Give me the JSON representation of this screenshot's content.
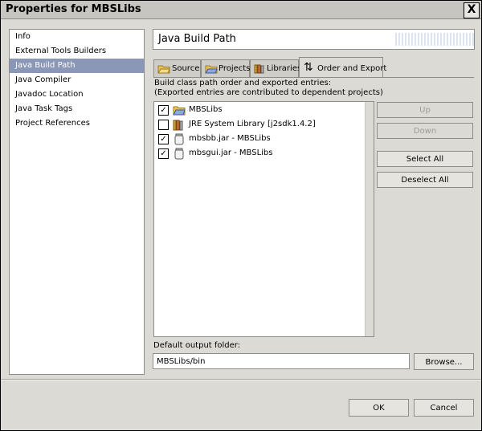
{
  "window": {
    "title": "Properties for MBSLibs",
    "close_glyph": "X"
  },
  "nav": {
    "items": [
      {
        "label": "Info"
      },
      {
        "label": "External Tools Builders"
      },
      {
        "label": "Java Build Path",
        "selected": true
      },
      {
        "label": "Java Compiler"
      },
      {
        "label": "Javadoc Location"
      },
      {
        "label": "Java Task Tags"
      },
      {
        "label": "Project References"
      }
    ]
  },
  "page": {
    "title": "Java Build Path"
  },
  "tabs": [
    {
      "label": "Source",
      "icon": "source-folder-icon"
    },
    {
      "label": "Projects",
      "icon": "project-folder-icon"
    },
    {
      "label": "Libraries",
      "icon": "libraries-icon"
    },
    {
      "label": "Order and Export",
      "icon": "order-arrows-icon",
      "active": true
    }
  ],
  "order_export": {
    "description_line1": "Build class path order and exported entries:",
    "description_line2": "(Exported entries are contributed to dependent projects)",
    "entries": [
      {
        "label": "MBSLibs",
        "checked": true,
        "icon": "project-folder-icon"
      },
      {
        "label": "JRE System Library [j2sdk1.4.2]",
        "checked": false,
        "icon": "library-books-icon"
      },
      {
        "label": "mbsbb.jar - MBSLibs",
        "checked": true,
        "icon": "jar-icon"
      },
      {
        "label": "mbsgui.jar - MBSLibs",
        "checked": true,
        "icon": "jar-icon"
      }
    ],
    "check_glyph": "✓",
    "buttons": {
      "up": "Up",
      "down": "Down",
      "select_all": "Select All",
      "deselect_all": "Deselect All"
    }
  },
  "output": {
    "label": "Default output folder:",
    "value": "MBSLibs/bin",
    "browse": "Browse..."
  },
  "dialog": {
    "ok": "OK",
    "cancel": "Cancel"
  },
  "colors": {
    "selection": "#8b97b6",
    "dialog_bg": "#dcdad5",
    "folder": "#e8c25a",
    "folder_dark": "#9a7a1e"
  }
}
